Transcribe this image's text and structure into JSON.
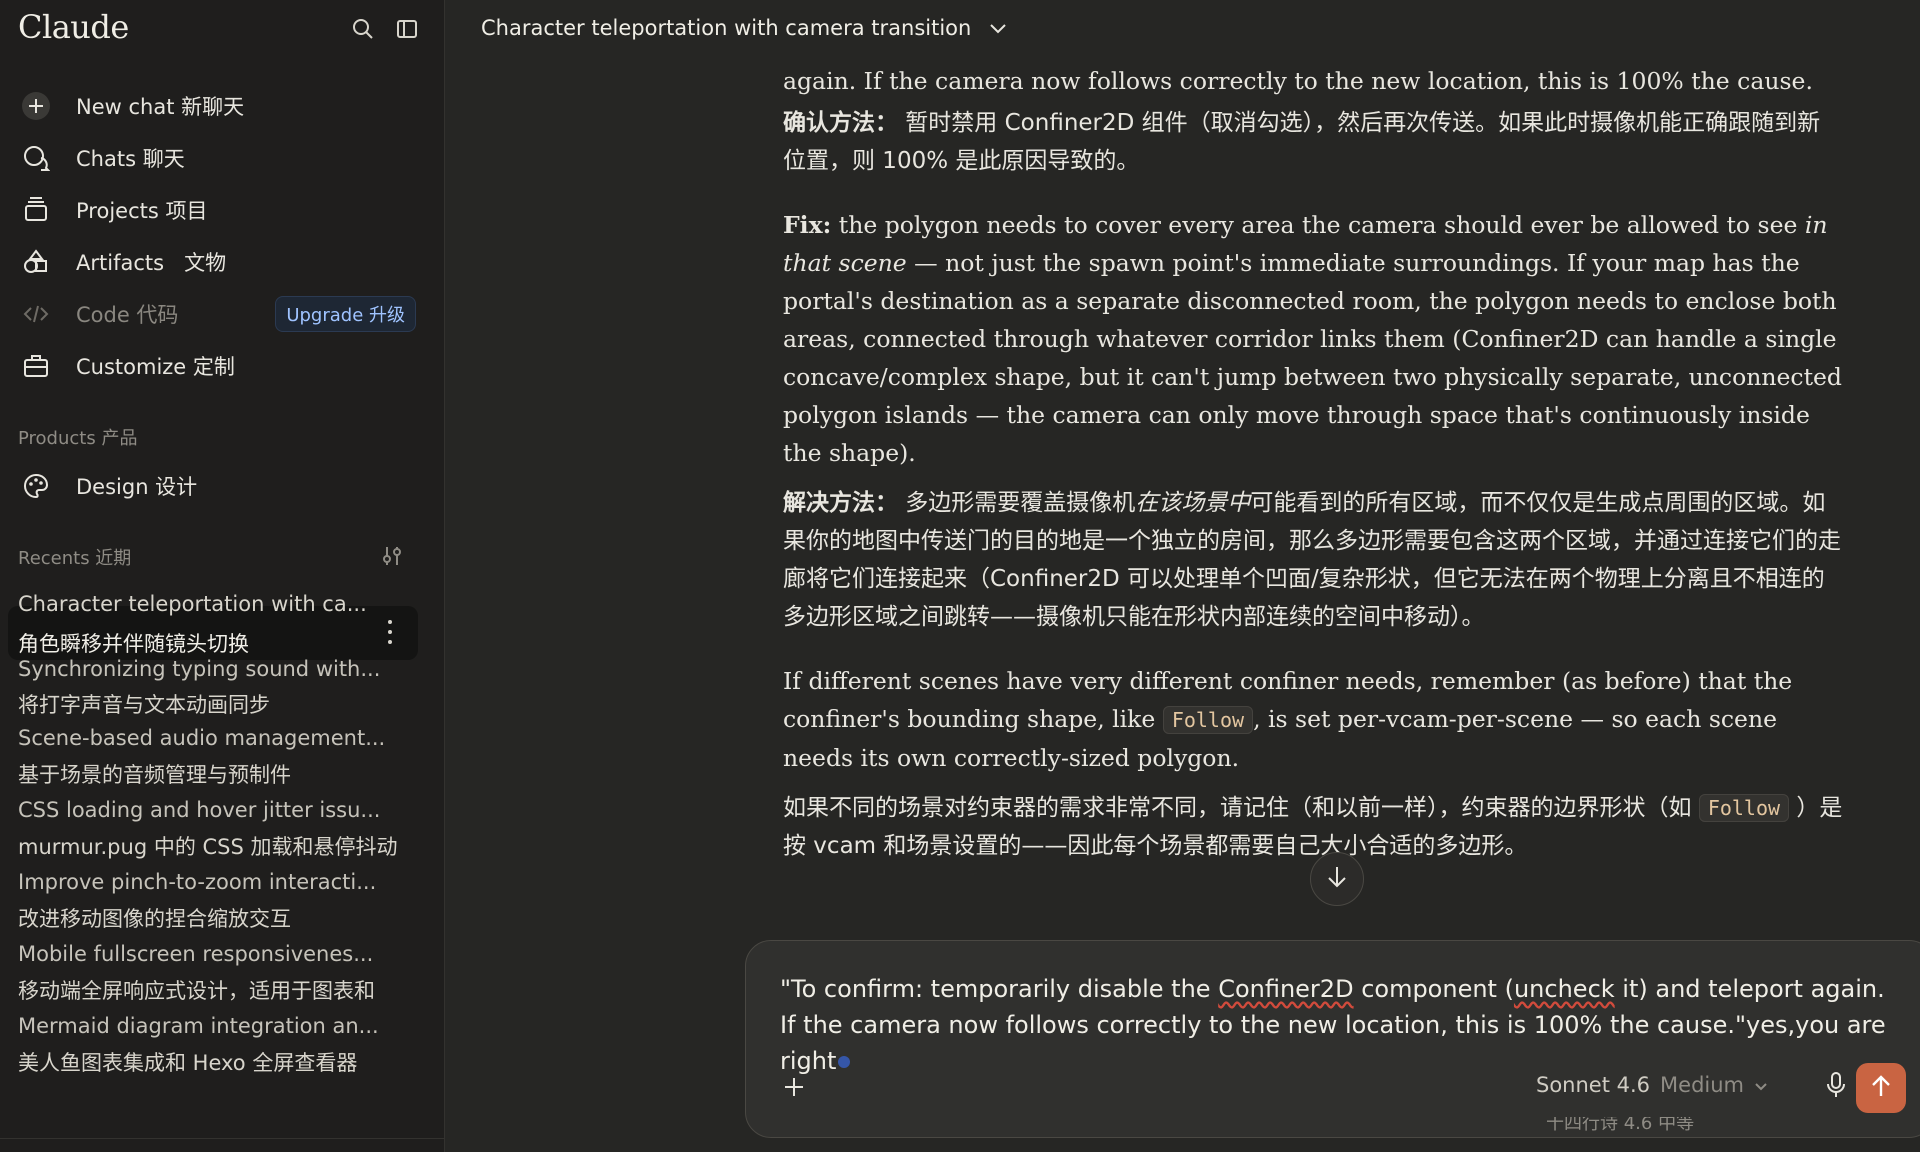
{
  "app": {
    "brand": "Claude"
  },
  "sidebar": {
    "nav": [
      {
        "label": "New chat 新聊天",
        "icon": "plus-icon"
      },
      {
        "label": "Chats 聊天",
        "icon": "chat-bubbles-icon"
      },
      {
        "label": "Projects 项目",
        "icon": "projects-icon"
      },
      {
        "label": "Artifacts   文物",
        "icon": "artifacts-icon"
      },
      {
        "label": "Code 代码",
        "icon": "code-icon",
        "badge": "Upgrade 升级"
      },
      {
        "label": "Customize 定制",
        "icon": "briefcase-icon"
      }
    ],
    "products_label": "Products 产品",
    "products": [
      {
        "label": "Design 设计",
        "icon": "palette-icon"
      }
    ],
    "recents_label": "Recents 近期",
    "recents_active": {
      "line1": "Character teleportation with ca...",
      "line2": "角色瞬移并伴随镜头切换"
    },
    "recents": [
      {
        "label": "Synchronizing typing sound with...",
        "ghost": true
      },
      {
        "label": "将打字声音与文本动画同步"
      },
      {
        "label": "Scene-based audio management...",
        "ghost": true
      },
      {
        "label": "基于场景的音频管理与预制件"
      },
      {
        "label": "CSS loading and hover jitter issu...",
        "ghost": true
      },
      {
        "label": "murmur.pug 中的 CSS 加载和悬停抖动"
      },
      {
        "label": "Improve pinch-to-zoom interacti...",
        "ghost": true
      },
      {
        "label": "改进移动图像的捏合缩放交互"
      },
      {
        "label": "Mobile fullscreen responsivenes...",
        "ghost": true
      },
      {
        "label": "移动端全屏响应式设计，适用于图表和"
      },
      {
        "label": "Mermaid diagram integration an...",
        "ghost": true
      },
      {
        "label": "美人鱼图表集成和 Hexo 全屏查看器"
      }
    ]
  },
  "header": {
    "title": "Character teleportation with camera transition"
  },
  "conversation": {
    "p0": "again. If the camera now follows correctly to the new location, this is 100% the cause.",
    "p1_label": "确认方法：",
    "p1_text": " 暂时禁用 Confiner2D 组件（取消勾选），然后再次传送。如果此时摄像机能正确跟随到新位置，则 100% 是此原因导致的。",
    "p2_label": "Fix:",
    "p2_a": " the polygon needs to cover every area the camera should ever be allowed to see ",
    "p2_em": "in that scene",
    "p2_b": " — not just the spawn point's immediate surroundings. If your map has the portal's destination as a separate disconnected room, the polygon needs to enclose both areas, connected through whatever corridor links them (Confiner2D can handle a single concave/complex shape, but it can't jump between two physically separate, unconnected polygon islands — the camera can only move through space that's continuously inside the shape).",
    "p3_label": "解决方法：",
    "p3_a": " 多边形需要覆盖摄像机",
    "p3_em": "在该场景中",
    "p3_b": "可能看到的所有区域，而不仅仅是生成点周围的区域。如果你的地图中传送门的目的地是一个独立的房间，那么多边形需要包含这两个区域，并通过连接它们的走廊将它们连接起来（Confiner2D 可以处理单个凹面/复杂形状，但它无法在两个物理上分离且不相连的多边形区域之间跳转——摄像机只能在形状内部连续的空间中移动）。",
    "p4_a": "If different scenes have very different confiner needs, remember (as before) that the confiner's bounding shape, like ",
    "p4_code": "Follow",
    "p4_b": ", is set per-vcam-per-scene — so each scene needs its own correctly-sized polygon.",
    "p5_a": "如果不同的场景对约束器的需求非常不同，请记住（和以前一样），约束器的边界形状（如 ",
    "p5_code": "Follow",
    "p5_b": " ）是按 vcam 和场景设置的——因此每个场景都需要自己大小合适的多边形。"
  },
  "composer": {
    "t1": "\"To confirm: temporarily disable the ",
    "t_sq1": "Confiner2D",
    "t2": " component (",
    "t_sq2": "uncheck",
    "t3": " it) and teleport again. If the camera now follows correctly to the new location, this is 100% the cause.\"yes,you are right",
    "model": "Sonnet 4.6",
    "effort": "Medium",
    "ghost": "十四行诗 4.6 中等"
  },
  "colors": {
    "accent": "#c96442",
    "background": "#262624",
    "sidebar": "#1f1e1d"
  }
}
